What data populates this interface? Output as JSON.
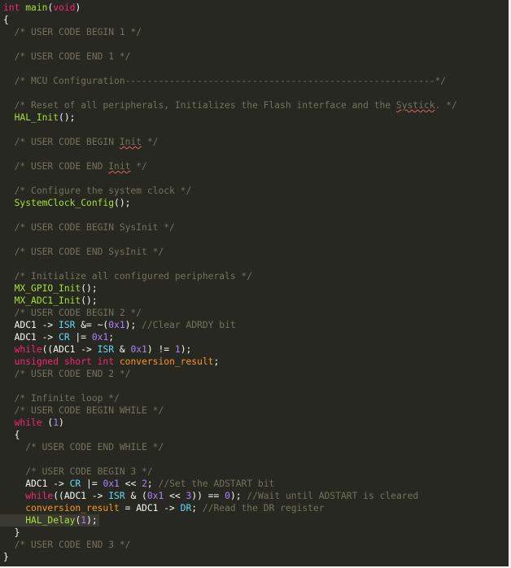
{
  "colors": {
    "background": "#272822",
    "text": "#f8f8f2",
    "comment": "#75715e",
    "keyword": "#f92672",
    "type": "#66d9ef",
    "function": "#a6e22e",
    "number": "#ae81ff",
    "member": "#66d9ef",
    "variable": "#fd971f",
    "squiggle": "#e3605a",
    "current_line": "#3b3a32"
  },
  "current_line_index": 42,
  "code": {
    "lines": [
      [
        {
          "t": "int",
          "c": "keyword"
        },
        {
          "t": " "
        },
        {
          "t": "main",
          "c": "function"
        },
        {
          "t": "("
        },
        {
          "t": "void",
          "c": "keyword"
        },
        {
          "t": ")"
        }
      ],
      [
        {
          "t": "{"
        }
      ],
      [
        {
          "t": "  "
        },
        {
          "t": "/* USER CODE BEGIN 1 */",
          "c": "comment"
        }
      ],
      [],
      [
        {
          "t": "  "
        },
        {
          "t": "/* USER CODE END 1 */",
          "c": "comment"
        }
      ],
      [],
      [
        {
          "t": "  "
        },
        {
          "t": "/* MCU Configuration--------------------------------------------------------*/",
          "c": "comment"
        }
      ],
      [],
      [
        {
          "t": "  "
        },
        {
          "t": "/* Reset of all peripherals, Initializes the Flash interface and the ",
          "c": "comment"
        },
        {
          "t": "Systick",
          "c": "comment",
          "sq": true
        },
        {
          "t": ". */",
          "c": "comment"
        }
      ],
      [
        {
          "t": "  "
        },
        {
          "t": "HAL_Init",
          "c": "function"
        },
        {
          "t": "();"
        }
      ],
      [],
      [
        {
          "t": "  "
        },
        {
          "t": "/* USER CODE BEGIN ",
          "c": "comment"
        },
        {
          "t": "Init",
          "c": "comment",
          "sq": true
        },
        {
          "t": " */",
          "c": "comment"
        }
      ],
      [],
      [
        {
          "t": "  "
        },
        {
          "t": "/* USER CODE END ",
          "c": "comment"
        },
        {
          "t": "Init",
          "c": "comment",
          "sq": true
        },
        {
          "t": " */",
          "c": "comment"
        }
      ],
      [],
      [
        {
          "t": "  "
        },
        {
          "t": "/* Configure the system clock */",
          "c": "comment"
        }
      ],
      [
        {
          "t": "  "
        },
        {
          "t": "SystemClock_Config",
          "c": "function"
        },
        {
          "t": "();"
        }
      ],
      [],
      [
        {
          "t": "  "
        },
        {
          "t": "/* USER CODE BEGIN SysInit */",
          "c": "comment"
        }
      ],
      [],
      [
        {
          "t": "  "
        },
        {
          "t": "/* USER CODE END SysInit */",
          "c": "comment"
        }
      ],
      [],
      [
        {
          "t": "  "
        },
        {
          "t": "/* Initialize all configured peripherals */",
          "c": "comment"
        }
      ],
      [
        {
          "t": "  "
        },
        {
          "t": "MX_GPIO_Init",
          "c": "function"
        },
        {
          "t": "();"
        }
      ],
      [
        {
          "t": "  "
        },
        {
          "t": "MX_ADC1_Init",
          "c": "function"
        },
        {
          "t": "();"
        }
      ],
      [
        {
          "t": "  "
        },
        {
          "t": "/* USER CODE BEGIN 2 */",
          "c": "comment"
        }
      ],
      [
        {
          "t": "  ADC1 -> "
        },
        {
          "t": "ISR",
          "c": "member"
        },
        {
          "t": " &= ~("
        },
        {
          "t": "0x1",
          "c": "number"
        },
        {
          "t": "); "
        },
        {
          "t": "//Clear ADRDY bit",
          "c": "comment"
        }
      ],
      [
        {
          "t": "  ADC1 -> "
        },
        {
          "t": "CR",
          "c": "member"
        },
        {
          "t": " |= "
        },
        {
          "t": "0x1",
          "c": "number"
        },
        {
          "t": ";"
        }
      ],
      [
        {
          "t": "  "
        },
        {
          "t": "while",
          "c": "keyword"
        },
        {
          "t": "((ADC1 -> "
        },
        {
          "t": "ISR",
          "c": "member"
        },
        {
          "t": " & "
        },
        {
          "t": "0x1",
          "c": "number"
        },
        {
          "t": ") != "
        },
        {
          "t": "1",
          "c": "number"
        },
        {
          "t": ");"
        }
      ],
      [
        {
          "t": "  "
        },
        {
          "t": "unsigned short int",
          "c": "keyword"
        },
        {
          "t": " "
        },
        {
          "t": "conversion_result",
          "c": "variable"
        },
        {
          "t": ";"
        }
      ],
      [
        {
          "t": "  "
        },
        {
          "t": "/* USER CODE END 2 */",
          "c": "comment"
        }
      ],
      [],
      [
        {
          "t": "  "
        },
        {
          "t": "/* Infinite loop */",
          "c": "comment"
        }
      ],
      [
        {
          "t": "  "
        },
        {
          "t": "/* USER CODE BEGIN WHILE */",
          "c": "comment"
        }
      ],
      [
        {
          "t": "  "
        },
        {
          "t": "while",
          "c": "keyword"
        },
        {
          "t": " ("
        },
        {
          "t": "1",
          "c": "number"
        },
        {
          "t": ")"
        }
      ],
      [
        {
          "t": "  {"
        }
      ],
      [
        {
          "t": "    "
        },
        {
          "t": "/* USER CODE END WHILE */",
          "c": "comment"
        }
      ],
      [],
      [
        {
          "t": "    "
        },
        {
          "t": "/* USER CODE BEGIN 3 */",
          "c": "comment"
        }
      ],
      [
        {
          "t": "    ADC1 -> "
        },
        {
          "t": "CR",
          "c": "member"
        },
        {
          "t": " |= "
        },
        {
          "t": "0x1",
          "c": "number"
        },
        {
          "t": " << "
        },
        {
          "t": "2",
          "c": "number"
        },
        {
          "t": "; "
        },
        {
          "t": "//Set the ADSTART bit",
          "c": "comment"
        }
      ],
      [
        {
          "t": "    "
        },
        {
          "t": "while",
          "c": "keyword"
        },
        {
          "t": "((ADC1 -> "
        },
        {
          "t": "ISR",
          "c": "member"
        },
        {
          "t": " & ("
        },
        {
          "t": "0x1",
          "c": "number"
        },
        {
          "t": " << "
        },
        {
          "t": "3",
          "c": "number"
        },
        {
          "t": ")) == "
        },
        {
          "t": "0",
          "c": "number"
        },
        {
          "t": "); "
        },
        {
          "t": "//Wait until ADSTART is cleared",
          "c": "comment"
        }
      ],
      [
        {
          "t": "    "
        },
        {
          "t": "conversion_result",
          "c": "variable"
        },
        {
          "t": " = ADC1 -> "
        },
        {
          "t": "DR",
          "c": "member"
        },
        {
          "t": "; "
        },
        {
          "t": "//Read the DR register",
          "c": "comment"
        }
      ],
      [
        {
          "t": "    "
        },
        {
          "t": "HAL_Delay",
          "c": "function"
        },
        {
          "t": "("
        },
        {
          "t": "1",
          "c": "number"
        },
        {
          "t": ");"
        }
      ],
      [
        {
          "t": "  }"
        }
      ],
      [
        {
          "t": "  "
        },
        {
          "t": "/* USER CODE END 3 */",
          "c": "comment"
        }
      ],
      [
        {
          "t": "}"
        }
      ]
    ]
  }
}
